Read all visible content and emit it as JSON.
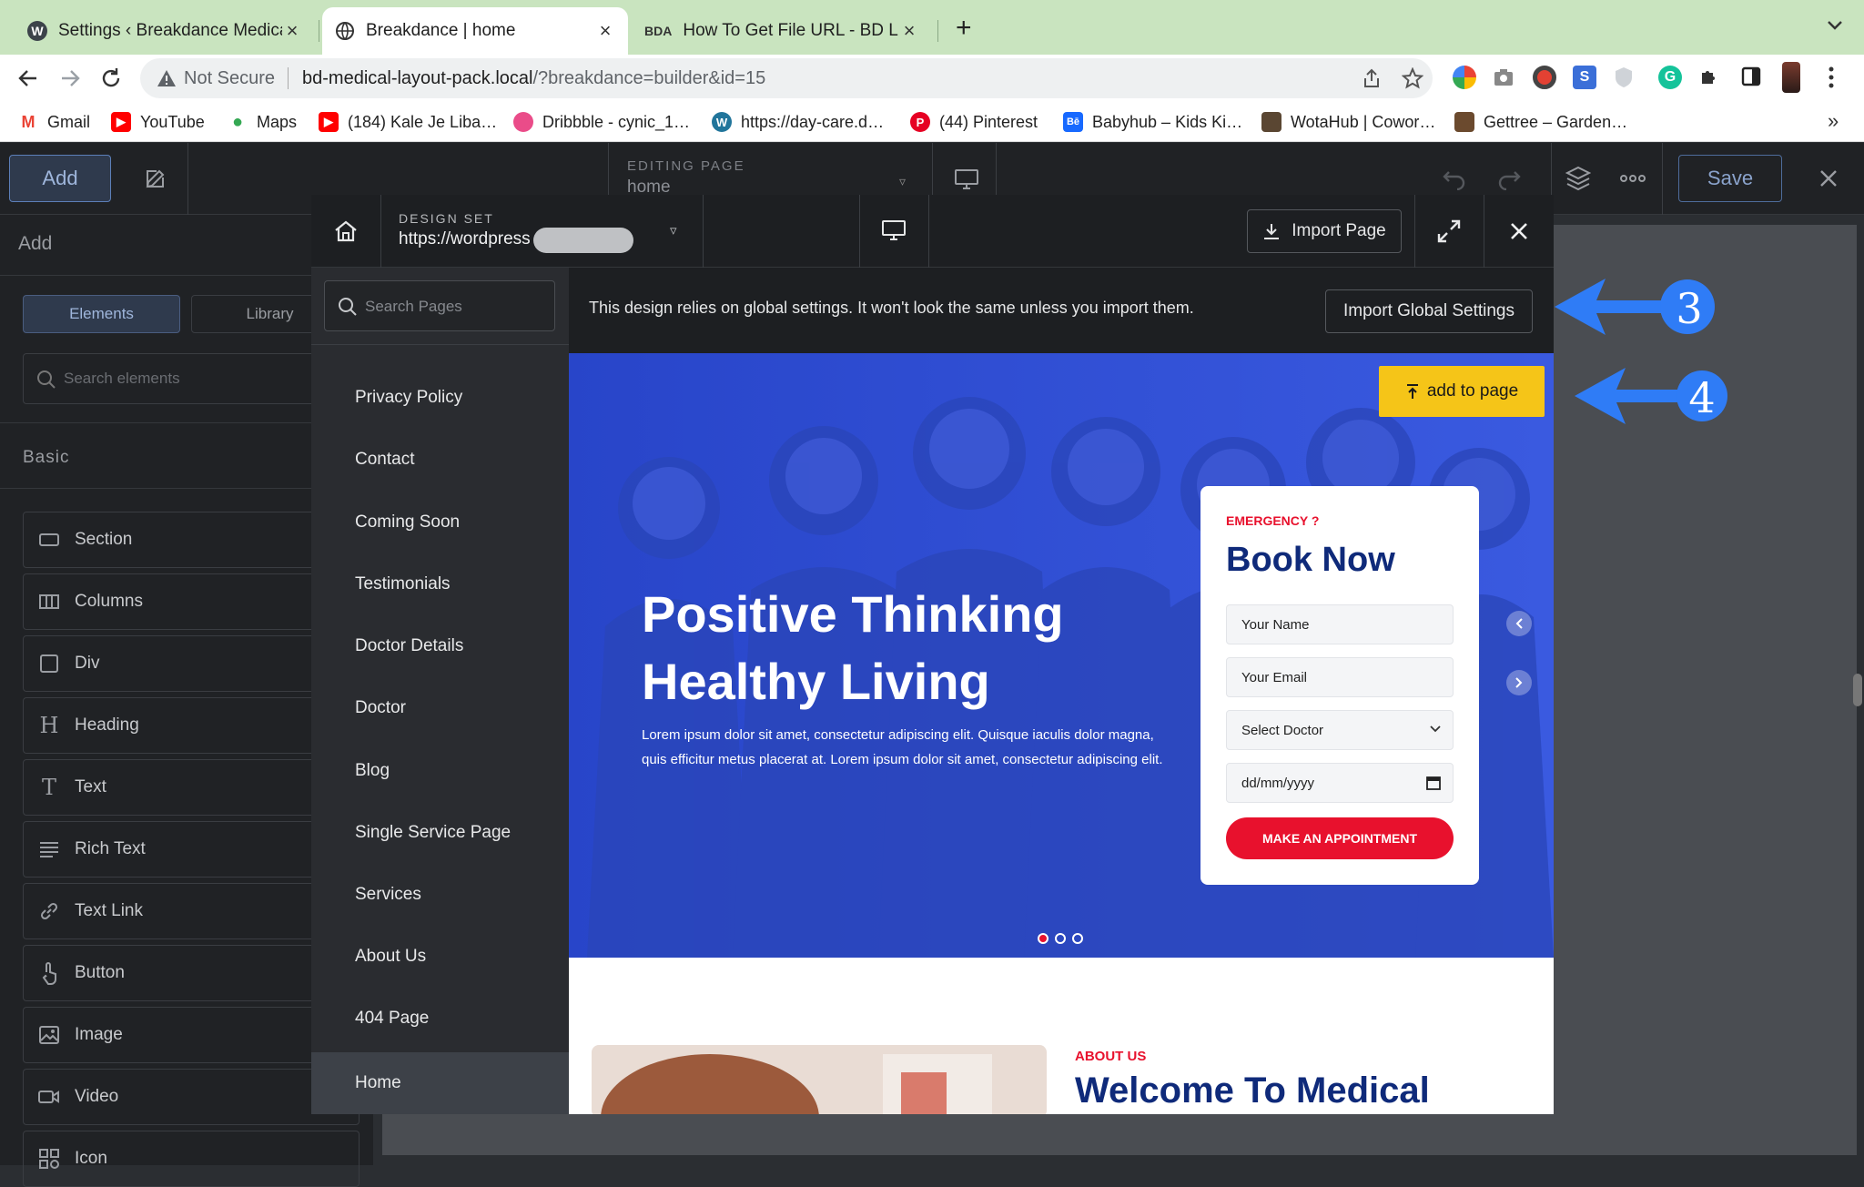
{
  "browser": {
    "tabs": [
      {
        "title": "Settings ‹ Breakdance Medical L…",
        "icon": "wordpress-icon"
      },
      {
        "title": "Breakdance | home",
        "icon": "globe-icon"
      },
      {
        "title": "How To Get File URL - BD Librar…",
        "icon": "bda-icon"
      }
    ],
    "new_tab": "+",
    "address": {
      "security": "Not Secure",
      "host": "bd-medical-layout-pack.local",
      "path": "/?breakdance=builder&id=15"
    },
    "bookmarks": [
      {
        "label": "Gmail",
        "color": "#ea4335",
        "glyph": "M"
      },
      {
        "label": "YouTube",
        "color": "#ff0000",
        "glyph": "▶"
      },
      {
        "label": "Maps",
        "color": "#34a853",
        "glyph": "●"
      },
      {
        "label": "(184) Kale Je Liba…",
        "color": "#ff0000",
        "glyph": "▶"
      },
      {
        "label": "Dribbble - cynic_1…",
        "color": "#ea4c89",
        "glyph": "●"
      },
      {
        "label": "https://day-care.d…",
        "color": "#21759b",
        "glyph": "W"
      },
      {
        "label": "(44) Pinterest",
        "color": "#e60023",
        "glyph": "P"
      },
      {
        "label": "Babyhub – Kids Ki…",
        "color": "#1769ff",
        "glyph": "Bē"
      },
      {
        "label": "WotaHub | Cowor…",
        "color": "#5a4632",
        "glyph": ""
      },
      {
        "label": "Gettree – Garden…",
        "color": "#6b4a2e",
        "glyph": ""
      }
    ],
    "more_bookmarks": "»"
  },
  "builder": {
    "add_button": "Add",
    "editing_label": "EDITING PAGE",
    "editing_value": "home",
    "save_button": "Save"
  },
  "left_panel": {
    "title": "Add",
    "tab_elements": "Elements",
    "tab_library": "Library",
    "search_placeholder": "Search elements",
    "section_basic": "Basic",
    "elements": [
      {
        "label": "Section",
        "icon": "section-icon"
      },
      {
        "label": "Columns",
        "icon": "columns-icon"
      },
      {
        "label": "Div",
        "icon": "div-icon"
      },
      {
        "label": "Heading",
        "icon": "heading-icon"
      },
      {
        "label": "Text",
        "icon": "text-icon"
      },
      {
        "label": "Rich Text",
        "icon": "rich-text-icon"
      },
      {
        "label": "Text Link",
        "icon": "link-icon"
      },
      {
        "label": "Button",
        "icon": "pointer-icon"
      },
      {
        "label": "Image",
        "icon": "image-icon"
      },
      {
        "label": "Video",
        "icon": "video-icon"
      },
      {
        "label": "Icon",
        "icon": "icon-icon"
      }
    ]
  },
  "modal": {
    "design_set_label": "DESIGN SET",
    "design_set_value": "https://wordpress",
    "import_page": "Import Page",
    "search_placeholder": "Search Pages",
    "pages": [
      "Privacy Policy",
      "Contact",
      "Coming Soon",
      "Testimonials",
      "Doctor Details",
      "Doctor",
      "Blog",
      "Single Service Page",
      "Services",
      "About Us",
      "404 Page",
      "Home"
    ],
    "active_page": "Home",
    "notice": "This design relies on global settings. It won't look the same unless you import them.",
    "import_global": "Import Global Settings",
    "add_to_page": "add to page"
  },
  "preview": {
    "hero_title_1": "Positive Thinking",
    "hero_title_2": "Healthy Living",
    "hero_text": "Lorem ipsum dolor sit amet, consectetur adipiscing elit. Quisque iaculis dolor magna, quis efficitur metus placerat at. Lorem ipsum dolor sit amet, consectetur adipiscing elit.",
    "form": {
      "eyebrow": "EMERGENCY ?",
      "title": "Book Now",
      "name_placeholder": "Your Name",
      "email_placeholder": "Your Email",
      "doctor_select": "Select Doctor",
      "date_placeholder": "dd/mm/yyyy",
      "submit": "MAKE AN APPOINTMENT"
    },
    "about_eyebrow": "ABOUT US",
    "about_title": "Welcome To Medical"
  },
  "callouts": {
    "step_3": "3",
    "step_4": "4"
  },
  "colors": {
    "accent_yellow": "#f5c518",
    "brand_red": "#e8112d",
    "brand_navy": "#0f2a7a",
    "callout_blue": "#2f7cf6"
  }
}
